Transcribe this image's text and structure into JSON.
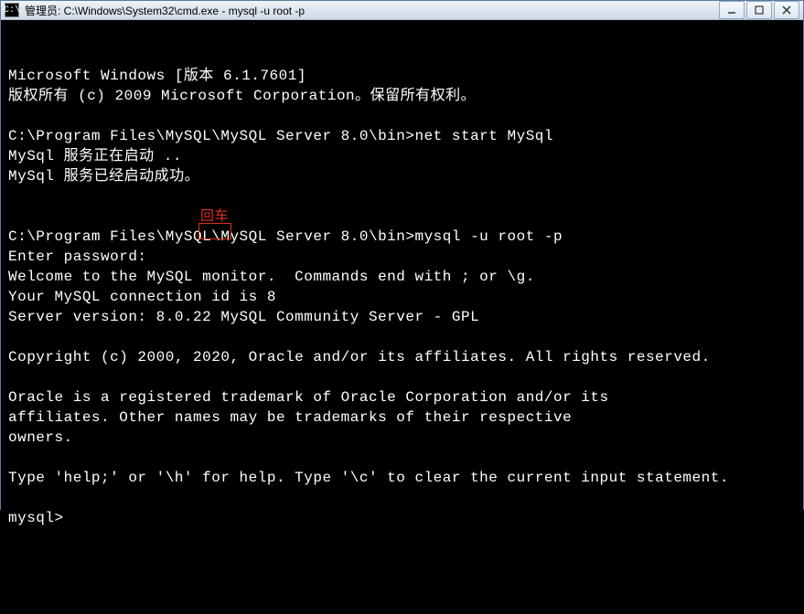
{
  "window": {
    "title": "管理员: C:\\Windows\\System32\\cmd.exe - mysql  -u root -p",
    "icon_label": "C:\\"
  },
  "terminal": {
    "lines": [
      "Microsoft Windows [版本 6.1.7601]",
      "版权所有 (c) 2009 Microsoft Corporation。保留所有权利。",
      "",
      "C:\\Program Files\\MySQL\\MySQL Server 8.0\\bin>net start MySql",
      "MySql 服务正在启动 ..",
      "MySql 服务已经启动成功。",
      "",
      "",
      "C:\\Program Files\\MySQL\\MySQL Server 8.0\\bin>mysql -u root -p",
      "Enter password:",
      "Welcome to the MySQL monitor.  Commands end with ; or \\g.",
      "Your MySQL connection id is 8",
      "Server version: 8.0.22 MySQL Community Server - GPL",
      "",
      "Copyright (c) 2000, 2020, Oracle and/or its affiliates. All rights reserved.",
      "",
      "Oracle is a registered trademark of Oracle Corporation and/or its",
      "affiliates. Other names may be trademarks of their respective",
      "owners.",
      "",
      "Type 'help;' or '\\h' for help. Type '\\c' to clear the current input statement.",
      "",
      "mysql>"
    ],
    "annotation_text": "回车"
  }
}
